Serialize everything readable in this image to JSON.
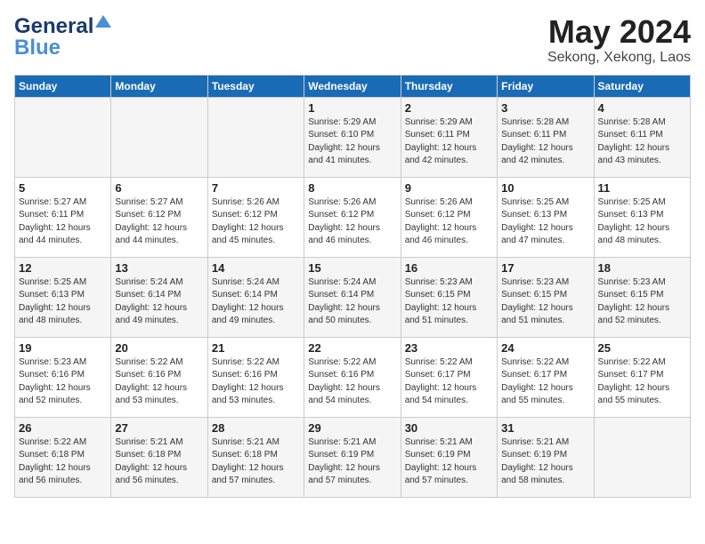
{
  "header": {
    "logo_line1": "General",
    "logo_line2": "Blue",
    "month": "May 2024",
    "location": "Sekong, Xekong, Laos"
  },
  "days_of_week": [
    "Sunday",
    "Monday",
    "Tuesday",
    "Wednesday",
    "Thursday",
    "Friday",
    "Saturday"
  ],
  "weeks": [
    [
      {
        "day": "",
        "info": ""
      },
      {
        "day": "",
        "info": ""
      },
      {
        "day": "",
        "info": ""
      },
      {
        "day": "1",
        "info": "Sunrise: 5:29 AM\nSunset: 6:10 PM\nDaylight: 12 hours\nand 41 minutes."
      },
      {
        "day": "2",
        "info": "Sunrise: 5:29 AM\nSunset: 6:11 PM\nDaylight: 12 hours\nand 42 minutes."
      },
      {
        "day": "3",
        "info": "Sunrise: 5:28 AM\nSunset: 6:11 PM\nDaylight: 12 hours\nand 42 minutes."
      },
      {
        "day": "4",
        "info": "Sunrise: 5:28 AM\nSunset: 6:11 PM\nDaylight: 12 hours\nand 43 minutes."
      }
    ],
    [
      {
        "day": "5",
        "info": "Sunrise: 5:27 AM\nSunset: 6:11 PM\nDaylight: 12 hours\nand 44 minutes."
      },
      {
        "day": "6",
        "info": "Sunrise: 5:27 AM\nSunset: 6:12 PM\nDaylight: 12 hours\nand 44 minutes."
      },
      {
        "day": "7",
        "info": "Sunrise: 5:26 AM\nSunset: 6:12 PM\nDaylight: 12 hours\nand 45 minutes."
      },
      {
        "day": "8",
        "info": "Sunrise: 5:26 AM\nSunset: 6:12 PM\nDaylight: 12 hours\nand 46 minutes."
      },
      {
        "day": "9",
        "info": "Sunrise: 5:26 AM\nSunset: 6:12 PM\nDaylight: 12 hours\nand 46 minutes."
      },
      {
        "day": "10",
        "info": "Sunrise: 5:25 AM\nSunset: 6:13 PM\nDaylight: 12 hours\nand 47 minutes."
      },
      {
        "day": "11",
        "info": "Sunrise: 5:25 AM\nSunset: 6:13 PM\nDaylight: 12 hours\nand 48 minutes."
      }
    ],
    [
      {
        "day": "12",
        "info": "Sunrise: 5:25 AM\nSunset: 6:13 PM\nDaylight: 12 hours\nand 48 minutes."
      },
      {
        "day": "13",
        "info": "Sunrise: 5:24 AM\nSunset: 6:14 PM\nDaylight: 12 hours\nand 49 minutes."
      },
      {
        "day": "14",
        "info": "Sunrise: 5:24 AM\nSunset: 6:14 PM\nDaylight: 12 hours\nand 49 minutes."
      },
      {
        "day": "15",
        "info": "Sunrise: 5:24 AM\nSunset: 6:14 PM\nDaylight: 12 hours\nand 50 minutes."
      },
      {
        "day": "16",
        "info": "Sunrise: 5:23 AM\nSunset: 6:15 PM\nDaylight: 12 hours\nand 51 minutes."
      },
      {
        "day": "17",
        "info": "Sunrise: 5:23 AM\nSunset: 6:15 PM\nDaylight: 12 hours\nand 51 minutes."
      },
      {
        "day": "18",
        "info": "Sunrise: 5:23 AM\nSunset: 6:15 PM\nDaylight: 12 hours\nand 52 minutes."
      }
    ],
    [
      {
        "day": "19",
        "info": "Sunrise: 5:23 AM\nSunset: 6:16 PM\nDaylight: 12 hours\nand 52 minutes."
      },
      {
        "day": "20",
        "info": "Sunrise: 5:22 AM\nSunset: 6:16 PM\nDaylight: 12 hours\nand 53 minutes."
      },
      {
        "day": "21",
        "info": "Sunrise: 5:22 AM\nSunset: 6:16 PM\nDaylight: 12 hours\nand 53 minutes."
      },
      {
        "day": "22",
        "info": "Sunrise: 5:22 AM\nSunset: 6:16 PM\nDaylight: 12 hours\nand 54 minutes."
      },
      {
        "day": "23",
        "info": "Sunrise: 5:22 AM\nSunset: 6:17 PM\nDaylight: 12 hours\nand 54 minutes."
      },
      {
        "day": "24",
        "info": "Sunrise: 5:22 AM\nSunset: 6:17 PM\nDaylight: 12 hours\nand 55 minutes."
      },
      {
        "day": "25",
        "info": "Sunrise: 5:22 AM\nSunset: 6:17 PM\nDaylight: 12 hours\nand 55 minutes."
      }
    ],
    [
      {
        "day": "26",
        "info": "Sunrise: 5:22 AM\nSunset: 6:18 PM\nDaylight: 12 hours\nand 56 minutes."
      },
      {
        "day": "27",
        "info": "Sunrise: 5:21 AM\nSunset: 6:18 PM\nDaylight: 12 hours\nand 56 minutes."
      },
      {
        "day": "28",
        "info": "Sunrise: 5:21 AM\nSunset: 6:18 PM\nDaylight: 12 hours\nand 57 minutes."
      },
      {
        "day": "29",
        "info": "Sunrise: 5:21 AM\nSunset: 6:19 PM\nDaylight: 12 hours\nand 57 minutes."
      },
      {
        "day": "30",
        "info": "Sunrise: 5:21 AM\nSunset: 6:19 PM\nDaylight: 12 hours\nand 57 minutes."
      },
      {
        "day": "31",
        "info": "Sunrise: 5:21 AM\nSunset: 6:19 PM\nDaylight: 12 hours\nand 58 minutes."
      },
      {
        "day": "",
        "info": ""
      }
    ]
  ]
}
